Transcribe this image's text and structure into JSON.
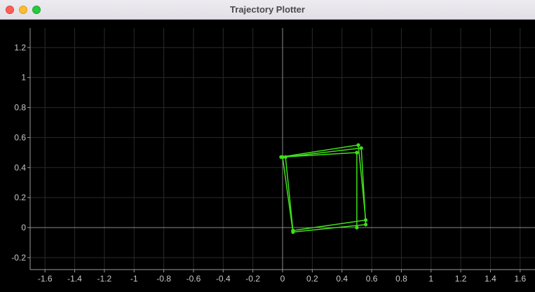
{
  "window": {
    "title": "Trajectory Plotter"
  },
  "colors": {
    "background": "#000000",
    "grid": "#2a2a2a",
    "axis": "#8a8a8a",
    "frame": "#9a9a9a",
    "tick_label": "#c8c8c8",
    "trajectory": "#3ee01a"
  },
  "chart_data": {
    "type": "line",
    "xlim": [
      -1.7,
      1.7
    ],
    "ylim": [
      -0.28,
      1.33
    ],
    "x_ticks": [
      -1.6,
      -1.4,
      -1.2,
      -1,
      -0.8,
      -0.6,
      -0.4,
      -0.2,
      0,
      0.2,
      0.4,
      0.6,
      0.8,
      1,
      1.2,
      1.4,
      1.6
    ],
    "x_tick_labels": [
      "-1.6",
      "-1.4",
      "-1.2",
      "-1",
      "-0.8",
      "-0.6",
      "-0.4",
      "-0.2",
      "0",
      "0.2",
      "0.4",
      "0.6",
      "0.8",
      "1",
      "1.2",
      "1.4",
      "1.6"
    ],
    "y_ticks": [
      -0.2,
      0,
      0.2,
      0.4,
      0.6,
      0.8,
      1,
      1.2
    ],
    "y_tick_labels": [
      "-0.2",
      "0",
      "0.2",
      "0.4",
      "0.6",
      "0.8",
      "1",
      "1.2"
    ],
    "grid": true,
    "series": [
      {
        "points": [
          [
            0.5,
            0.0
          ],
          [
            0.5,
            0.5
          ],
          [
            0.0,
            0.47
          ],
          [
            0.07,
            -0.03
          ],
          [
            0.56,
            0.02
          ],
          [
            0.53,
            0.53
          ],
          [
            0.02,
            0.47
          ],
          [
            0.07,
            -0.02
          ],
          [
            0.56,
            0.05
          ],
          [
            0.51,
            0.55
          ],
          [
            -0.01,
            0.47
          ]
        ]
      }
    ]
  }
}
